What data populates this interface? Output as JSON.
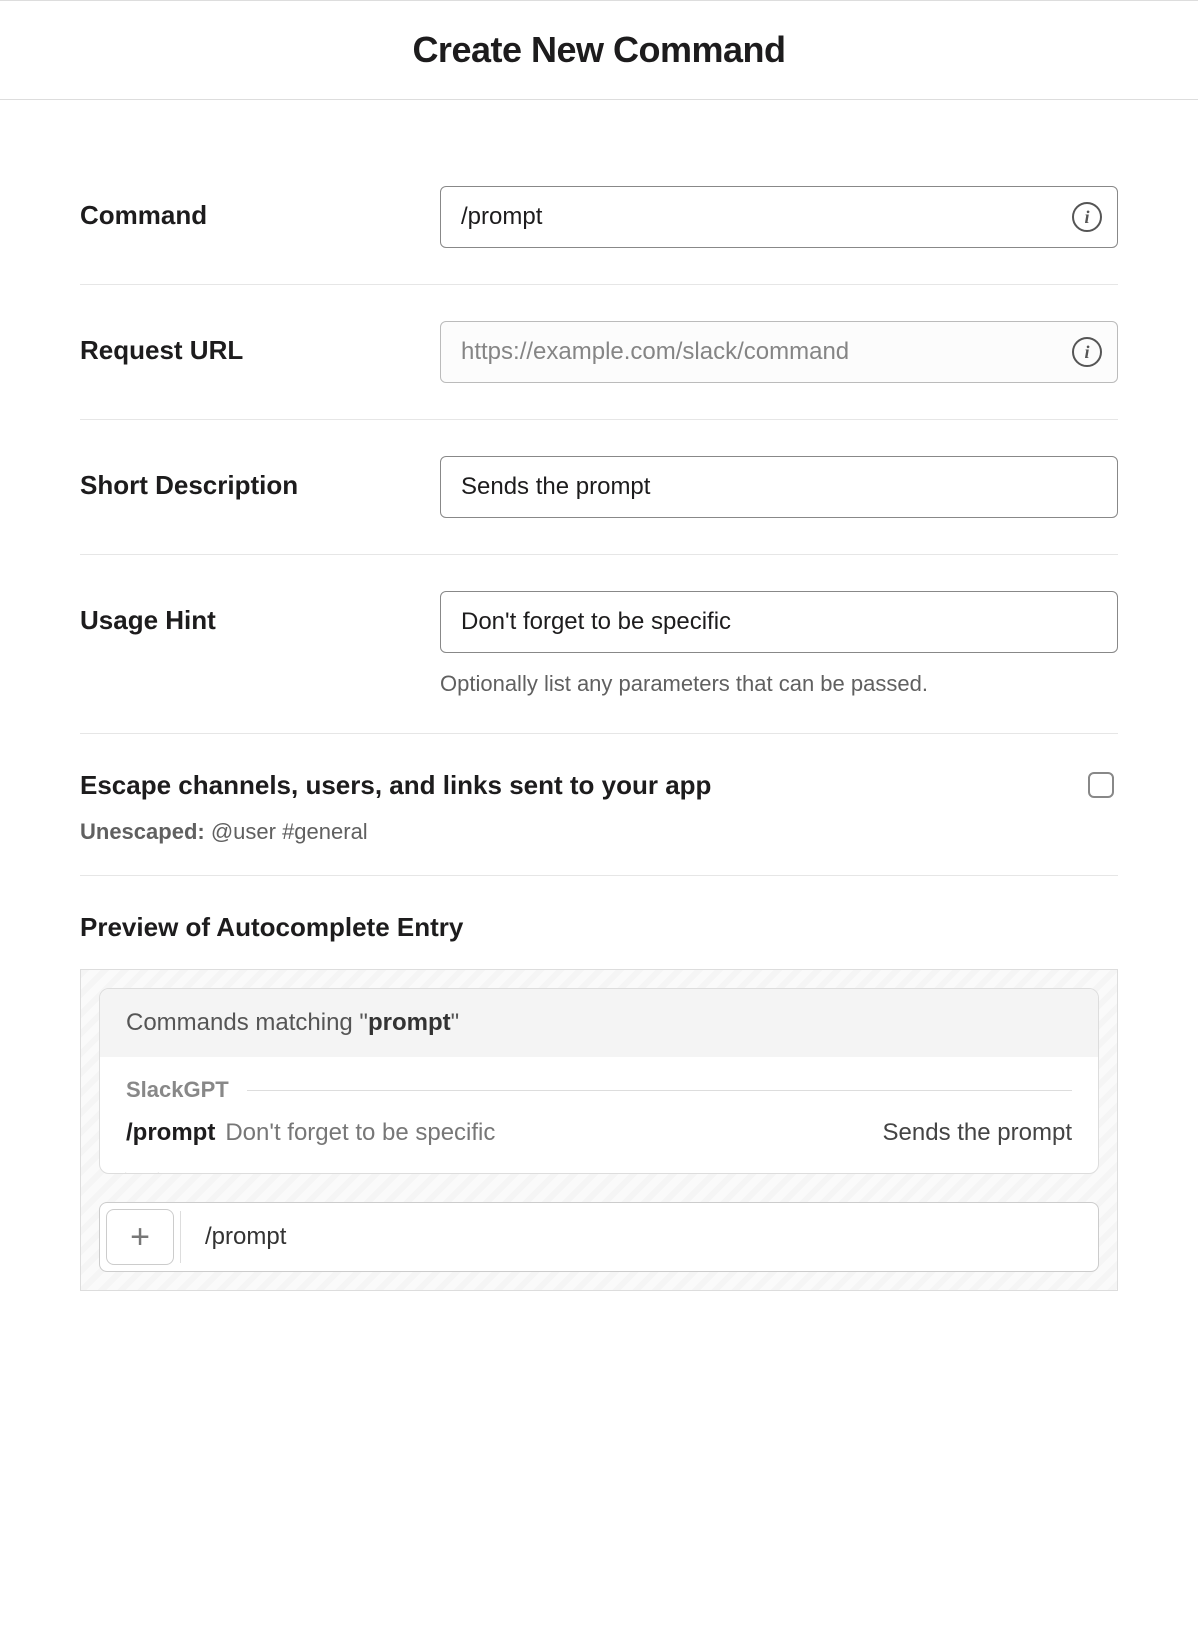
{
  "header": {
    "title": "Create New Command"
  },
  "form": {
    "command": {
      "label": "Command",
      "value": "/prompt"
    },
    "request_url": {
      "label": "Request URL",
      "placeholder": "https://example.com/slack/command",
      "value": ""
    },
    "short_description": {
      "label": "Short Description",
      "value": "Sends the prompt"
    },
    "usage_hint": {
      "label": "Usage Hint",
      "value": "Don't forget to be specific",
      "helper": "Optionally list any parameters that can be passed."
    }
  },
  "escape": {
    "label": "Escape channels, users, and links sent to your app",
    "sub_label": "Unescaped:",
    "sub_value": " @user #general",
    "checked": false
  },
  "preview": {
    "title": "Preview of Autocomplete Entry",
    "header_prefix": "Commands matching \"",
    "header_query": "prompt",
    "header_suffix": "\"",
    "app_name": "SlackGPT",
    "cmd": "/prompt",
    "hint": "Don't forget to be specific",
    "desc": "Sends the prompt",
    "input_text": "/prompt"
  }
}
